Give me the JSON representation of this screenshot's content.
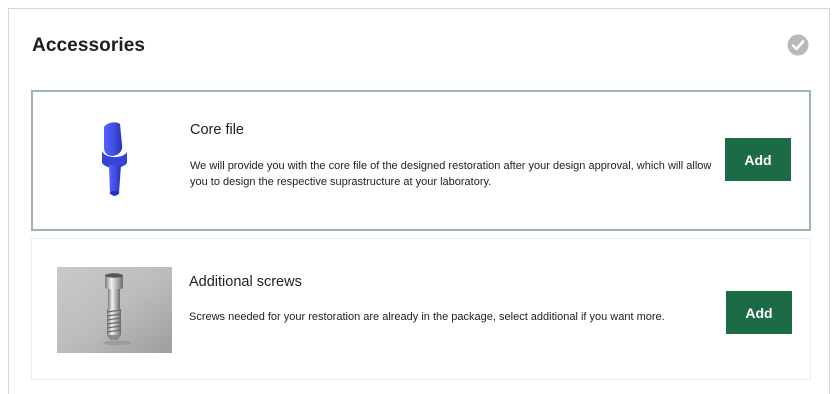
{
  "panel": {
    "title": "Accessories",
    "status_icon": "check-circle-icon"
  },
  "items": [
    {
      "title": "Core file",
      "description": "We will provide you with the core file of the designed restoration after your design approval, which will allow you to design the respective suprastructure at your laboratory.",
      "button_label": "Add",
      "image": "abutment-core-icon",
      "selected": true
    },
    {
      "title": "Additional screws",
      "description": "Screws needed for your restoration are already in the package, select additional if you want more.",
      "button_label": "Add",
      "image": "screw-photo",
      "selected": false
    }
  ],
  "colors": {
    "button": "#1c6b47",
    "selected_border": "#9bb7aa",
    "check_icon": "#b9b9b9",
    "core_model": "#3f4de0"
  }
}
